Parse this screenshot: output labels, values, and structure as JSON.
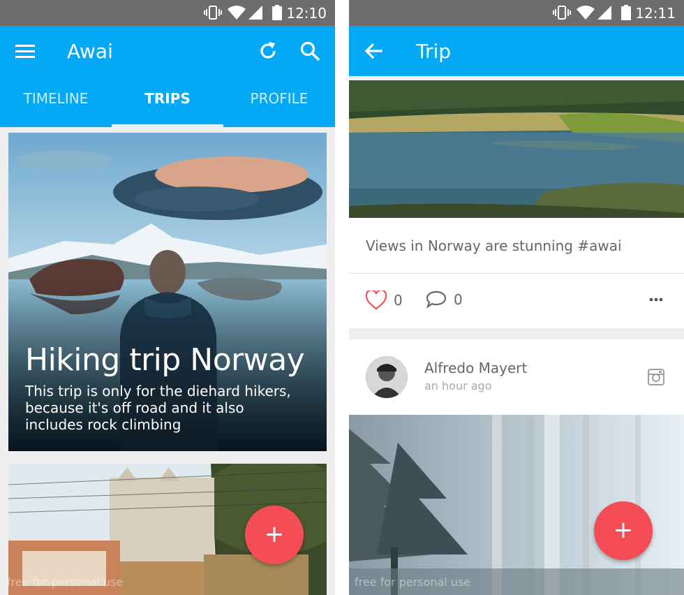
{
  "status_bar_left": {
    "time": "12:10"
  },
  "status_bar_right": {
    "time": "12:11"
  },
  "icons": {
    "menu": "menu-icon",
    "refresh": "refresh-icon",
    "search": "search-icon",
    "back": "back-arrow-icon",
    "heart": "heart-icon",
    "comment": "comment-icon",
    "more": "more-horizontal-icon",
    "instagram": "instagram-icon",
    "add": "plus-icon"
  },
  "left": {
    "app_title": "Awai",
    "tabs": [
      {
        "label": "TIMELINE",
        "active": false
      },
      {
        "label": "TRIPS",
        "active": true
      },
      {
        "label": "PROFILE",
        "active": false
      }
    ],
    "trip_card": {
      "title": "Hiking trip Norway",
      "description": "This trip is only for the diehard hikers, because it's off road and it also includes rock climbing"
    },
    "fab_label": "+",
    "watermark": "free for personal use"
  },
  "right": {
    "title": "Trip",
    "post": {
      "caption": "Views in Norway are stunning #awai",
      "likes": "0",
      "comments": "0"
    },
    "author": {
      "name": "Alfredo Mayert",
      "time": "an hour ago"
    },
    "fab_label": "+",
    "watermark": "free for personal use"
  },
  "colors": {
    "app_bar": "#03a9f4",
    "status_bar": "#6d6d6d",
    "fab": "#f44d55",
    "heart": "#f44d55"
  }
}
